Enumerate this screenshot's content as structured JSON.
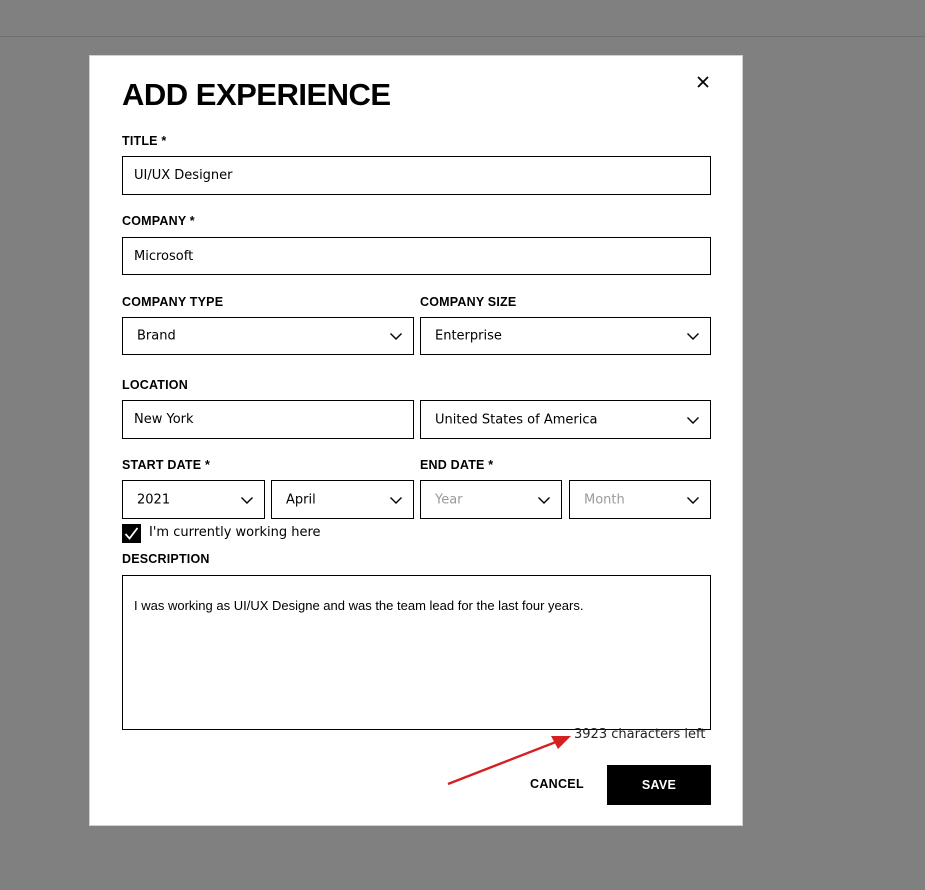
{
  "modal": {
    "title": "ADD EXPERIENCE",
    "close_icon": "close-icon"
  },
  "fields": {
    "title": {
      "label": "TITLE  *",
      "value": "UI/UX Designer"
    },
    "company": {
      "label": "COMPANY  *",
      "value": "Microsoft"
    },
    "company_type": {
      "label": "COMPANY TYPE",
      "value": "Brand"
    },
    "company_size": {
      "label": "COMPANY SIZE",
      "value": "Enterprise"
    },
    "location": {
      "label": "LOCATION",
      "city": "New York",
      "country": "United States of America"
    },
    "start_date": {
      "label": "START DATE  *",
      "year": "2021",
      "month": "April"
    },
    "end_date": {
      "label": "END DATE  *",
      "year_placeholder": "Year",
      "month_placeholder": "Month"
    },
    "currently_working": {
      "label": "I'm currently working here",
      "checked": true
    },
    "description": {
      "label": "DESCRIPTION",
      "value": "I was working as UI/UX Designe and was the team lead for the last four years.",
      "counter": "3923 characters left"
    }
  },
  "actions": {
    "cancel_label": "CANCEL",
    "save_label": "SAVE"
  },
  "colors": {
    "overlay": "#808080",
    "primary": "#000000",
    "annotation_arrow": "#d42020"
  },
  "icons": {
    "dropdown": "chevron-down-icon",
    "checkbox": "checkmark-icon",
    "annotation": "arrow-annotation"
  }
}
